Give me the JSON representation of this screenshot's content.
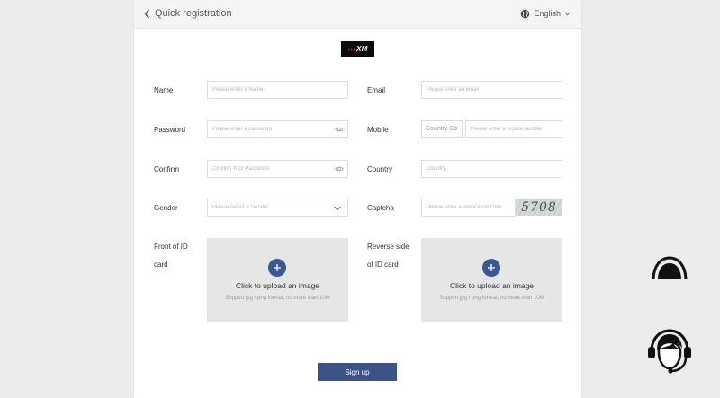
{
  "header": {
    "title": "Quick registration",
    "language": "English"
  },
  "logo": {
    "text": "XM"
  },
  "form": {
    "name": {
      "label": "Name",
      "placeholder": "Please enter a Name"
    },
    "email": {
      "label": "Email",
      "placeholder": "Please enter an email"
    },
    "password": {
      "label": "Password",
      "placeholder": "Please enter a password"
    },
    "mobile": {
      "label": "Mobile",
      "country_code": "Country Co",
      "placeholder": "Please enter a mobile number"
    },
    "confirm": {
      "label": "Confirm",
      "placeholder": "Confirm Your Password"
    },
    "country": {
      "label": "Country",
      "placeholder": "Country"
    },
    "gender": {
      "label": "Gender",
      "placeholder": "Please select a Gender"
    },
    "captcha": {
      "label": "Captcha",
      "placeholder": "Please enter a verification code",
      "image_text": "5708"
    },
    "front_id": {
      "label_line1": "Front of ID",
      "label_line2": "card",
      "title": "Click to upload an image",
      "hint": "Support jpg / png format, no more than 10M"
    },
    "reverse_id": {
      "label_line1": "Reverse side",
      "label_line2": "of ID card",
      "title": "Click to upload an image",
      "hint": "Support jpg / png format, no more than 10M"
    },
    "submit_label": "Sign up"
  },
  "icons": {
    "back": "chevron-left-icon",
    "language": "globe-icon",
    "language_toggle": "chevron-down-icon",
    "password_visibility": "eye-icon",
    "gender_select": "chevron-down-icon",
    "upload": "plus-icon",
    "support": "customer-support-headset-icon"
  },
  "colors": {
    "primary": "#3c5388",
    "upload_plus": "#3a5894",
    "logo_bg": "#0c0c0c",
    "logo_mark": "#e0262d",
    "page_bg": "#ececec",
    "upload_bg": "#e6e6e6"
  }
}
